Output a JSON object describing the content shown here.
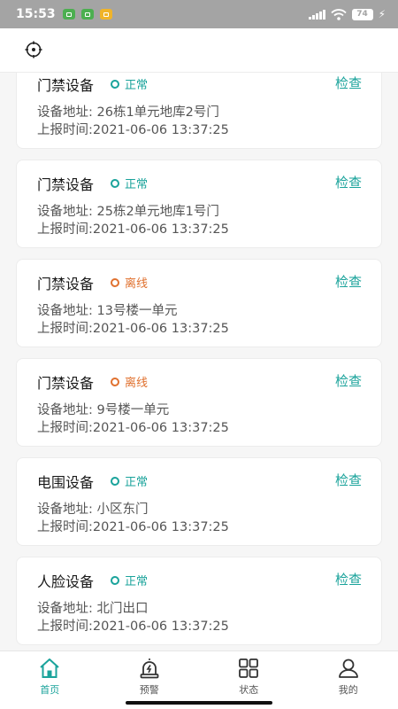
{
  "status_bar": {
    "time": "15:53",
    "battery": "74"
  },
  "tabs": [
    {
      "label": "首页"
    },
    {
      "label": "预警"
    },
    {
      "label": "状态"
    },
    {
      "label": "我的"
    }
  ],
  "devices": [
    {
      "name": "门禁设备",
      "status": "正常",
      "action": "检查",
      "address": "设备地址: 26栋1单元地库2号门",
      "report_time": "上报时间:2021-06-06 13:37:25"
    },
    {
      "name": "门禁设备",
      "status": "正常",
      "action": "检查",
      "address": "设备地址: 25栋2单元地库1号门",
      "report_time": "上报时间:2021-06-06 13:37:25"
    },
    {
      "name": "门禁设备",
      "status": "离线",
      "action": "检查",
      "address": "设备地址: 13号楼一单元",
      "report_time": "上报时间:2021-06-06 13:37:25"
    },
    {
      "name": "门禁设备",
      "status": "离线",
      "action": "检查",
      "address": "设备地址: 9号楼一单元",
      "report_time": "上报时间:2021-06-06 13:37:25"
    },
    {
      "name": "电围设备",
      "status": "正常",
      "action": "检查",
      "address": "设备地址: 小区东门",
      "report_time": "上报时间:2021-06-06 13:37:25"
    },
    {
      "name": "人脸设备",
      "status": "正常",
      "action": "检查",
      "address": "设备地址: 北门出口",
      "report_time": "上报时间:2021-06-06 13:37:25"
    }
  ],
  "colors": {
    "accent": "#1aa39b",
    "offline": "#e0712f"
  }
}
